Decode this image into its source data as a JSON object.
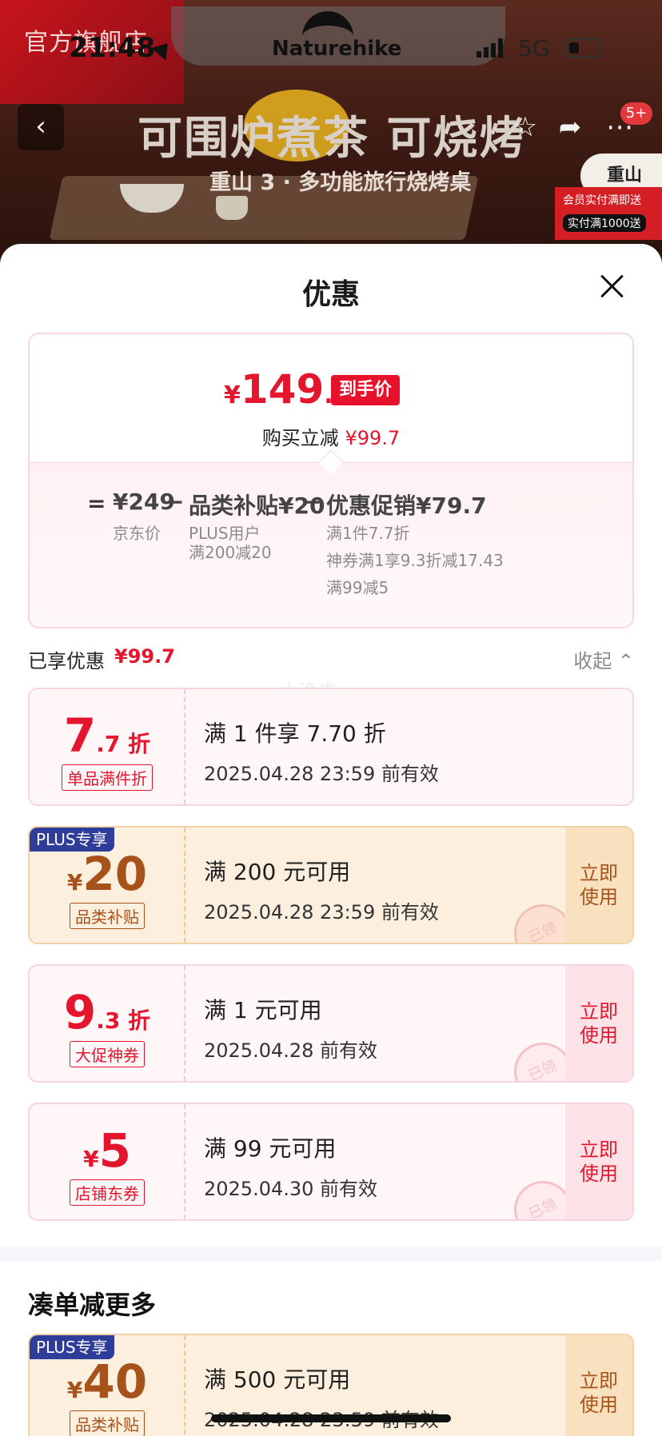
{
  "status_bar": {
    "time": "21:48",
    "network": "5G"
  },
  "store": {
    "name": "官方旗舰店",
    "brand": "Naturehike"
  },
  "product_banner": {
    "headline": "可围炉煮茶 可烧烤",
    "subline": "重山 3 · 多功能旅行烧烤桌",
    "cart_badge": "5+",
    "side_tag": "重山",
    "side_promo_1": "会员实付满即送",
    "side_promo_2": "实付满1000送"
  },
  "sheet": {
    "title": "优惠"
  },
  "summary": {
    "yen": "¥",
    "price_int": "149",
    "price_dec": ".3",
    "price_tag": "到手价",
    "instant_label": "购买立减",
    "instant_value": "¥99.7",
    "breakdown": {
      "eq": "=",
      "base_price": "¥249",
      "base_label": "京东价",
      "minus1": "−",
      "subsidy": "品类补贴¥20",
      "subsidy_sub1": "PLUS用户",
      "subsidy_sub2": "满200减20",
      "minus2": "−",
      "promo": "优惠促销¥79.7",
      "promo_sub1": "满1件7.7折",
      "promo_sub2": "神券满1享9.3折减17.43",
      "promo_sub3": "满99减5"
    }
  },
  "enjoyed": {
    "label": "已享优惠",
    "value": "¥99.7",
    "collapse": "收起"
  },
  "watermark": "小渔夫",
  "coupons": [
    {
      "type": "normal",
      "value_main": "7",
      "value_suffix": ".7 折",
      "value_prefix": "",
      "tag": "单品满件折",
      "condition": "满 1 件享 7.70 折",
      "expiry": "2025.04.28 23:59 前有效",
      "use_label": "",
      "stamp": ""
    },
    {
      "type": "plus",
      "badge": "PLUS专享",
      "value_prefix": "¥",
      "value_main": "20",
      "value_suffix": "",
      "tag": "品类补贴",
      "condition": "满 200 元可用",
      "expiry": "2025.04.28 23:59 前有效",
      "use_label": "立即 使用",
      "stamp": "已领"
    },
    {
      "type": "normal",
      "value_main": "9",
      "value_suffix": ".3 折",
      "value_prefix": "",
      "tag": "大促神券",
      "condition": "满 1 元可用",
      "expiry": "2025.04.28 前有效",
      "use_label": "立即 使用",
      "stamp": "已领"
    },
    {
      "type": "normal",
      "value_prefix": "¥",
      "value_main": "5",
      "value_suffix": "",
      "tag": "店铺东券",
      "condition": "满 99 元可用",
      "expiry": "2025.04.30 前有效",
      "use_label": "立即 使用",
      "stamp": "已领"
    }
  ],
  "more_section": {
    "title": "凑单减更多",
    "coupon": {
      "badge": "PLUS专享",
      "value_prefix": "¥",
      "value_main": "40",
      "tag": "品类补贴",
      "condition": "满 500 元可用",
      "expiry": "2025.04.28 23:59 前有效",
      "use_label": "立即 使用"
    }
  },
  "colors": {
    "accent_red": "#e4162d",
    "plus_brown": "#a8521b",
    "plus_blue": "#2f3d9a"
  }
}
